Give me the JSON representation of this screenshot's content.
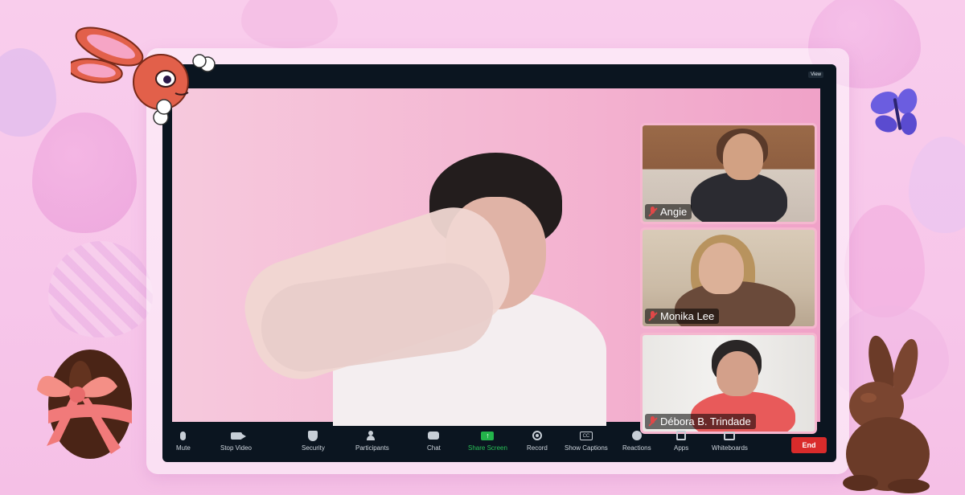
{
  "window": {
    "view_label": "View"
  },
  "participants": [
    {
      "name": "Angie",
      "muted": true
    },
    {
      "name": "Monika Lee",
      "muted": true
    },
    {
      "name": "Débora B. Trindade",
      "muted": true
    }
  ],
  "toolbar": {
    "mute_label": "Mute",
    "stop_video_label": "Stop Video",
    "security_label": "Security",
    "participants_label": "Participants",
    "chat_label": "Chat",
    "share_screen_label": "Share Screen",
    "record_label": "Record",
    "show_captions_label": "Show Captions",
    "reactions_label": "Reactions",
    "apps_label": "Apps",
    "whiteboards_label": "Whiteboards",
    "end_label": "End"
  },
  "icons": {
    "mic": "mic-icon",
    "mic_off": "mic-off-icon",
    "camera": "camera-icon",
    "security": "shield-icon",
    "participants": "participants-icon",
    "chat": "chat-icon",
    "share": "share-screen-icon",
    "record": "record-icon",
    "captions": "cc-icon",
    "reactions": "smiley-icon",
    "apps": "apps-icon",
    "whiteboards": "whiteboard-icon"
  },
  "colors": {
    "share_accent": "#29c257",
    "end_button": "#d92b2b",
    "mute_indicator": "#e04848",
    "tile_border": "#f5b7cf"
  }
}
